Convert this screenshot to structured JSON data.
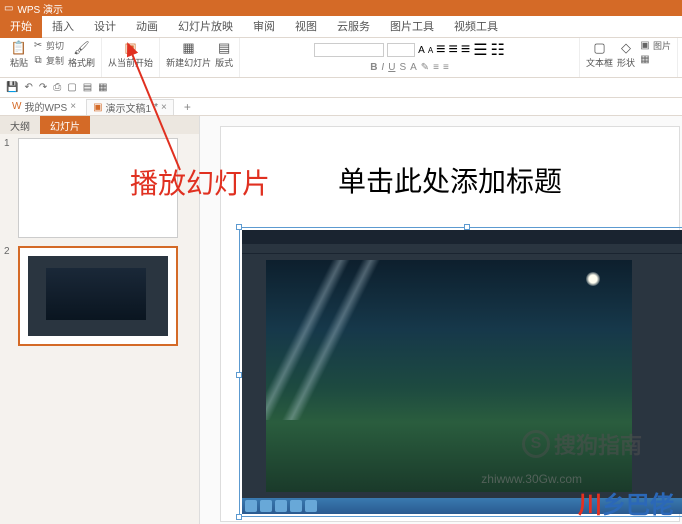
{
  "app": {
    "name": "WPS 演示"
  },
  "menu": [
    "开始",
    "插入",
    "设计",
    "动画",
    "幻灯片放映",
    "审阅",
    "视图",
    "云服务",
    "图片工具",
    "视频工具"
  ],
  "active_menu": 0,
  "ribbon": {
    "paste": "粘贴",
    "cut": "剪切",
    "copy": "复制",
    "format_painter": "格式刷",
    "from_current": "从当前开始",
    "new_slide": "新建幻灯片",
    "layout": "版式",
    "shape": "形状",
    "picture": "图片",
    "text_box": "文本框"
  },
  "doc_tabs": [
    {
      "label": "我的WPS",
      "active": false
    },
    {
      "label": "演示文稿1",
      "active": true
    }
  ],
  "outline": {
    "tabs": [
      "大纲",
      "幻灯片"
    ],
    "active": 1,
    "slides": [
      1,
      2
    ]
  },
  "slide": {
    "title_placeholder": "单击此处添加标题"
  },
  "annotation": "播放幻灯片",
  "watermarks": {
    "sogou": "搜狗指南",
    "url": "zhiwww.30Gw.com",
    "brand1": "川",
    "brand2": "乡巴佬"
  }
}
